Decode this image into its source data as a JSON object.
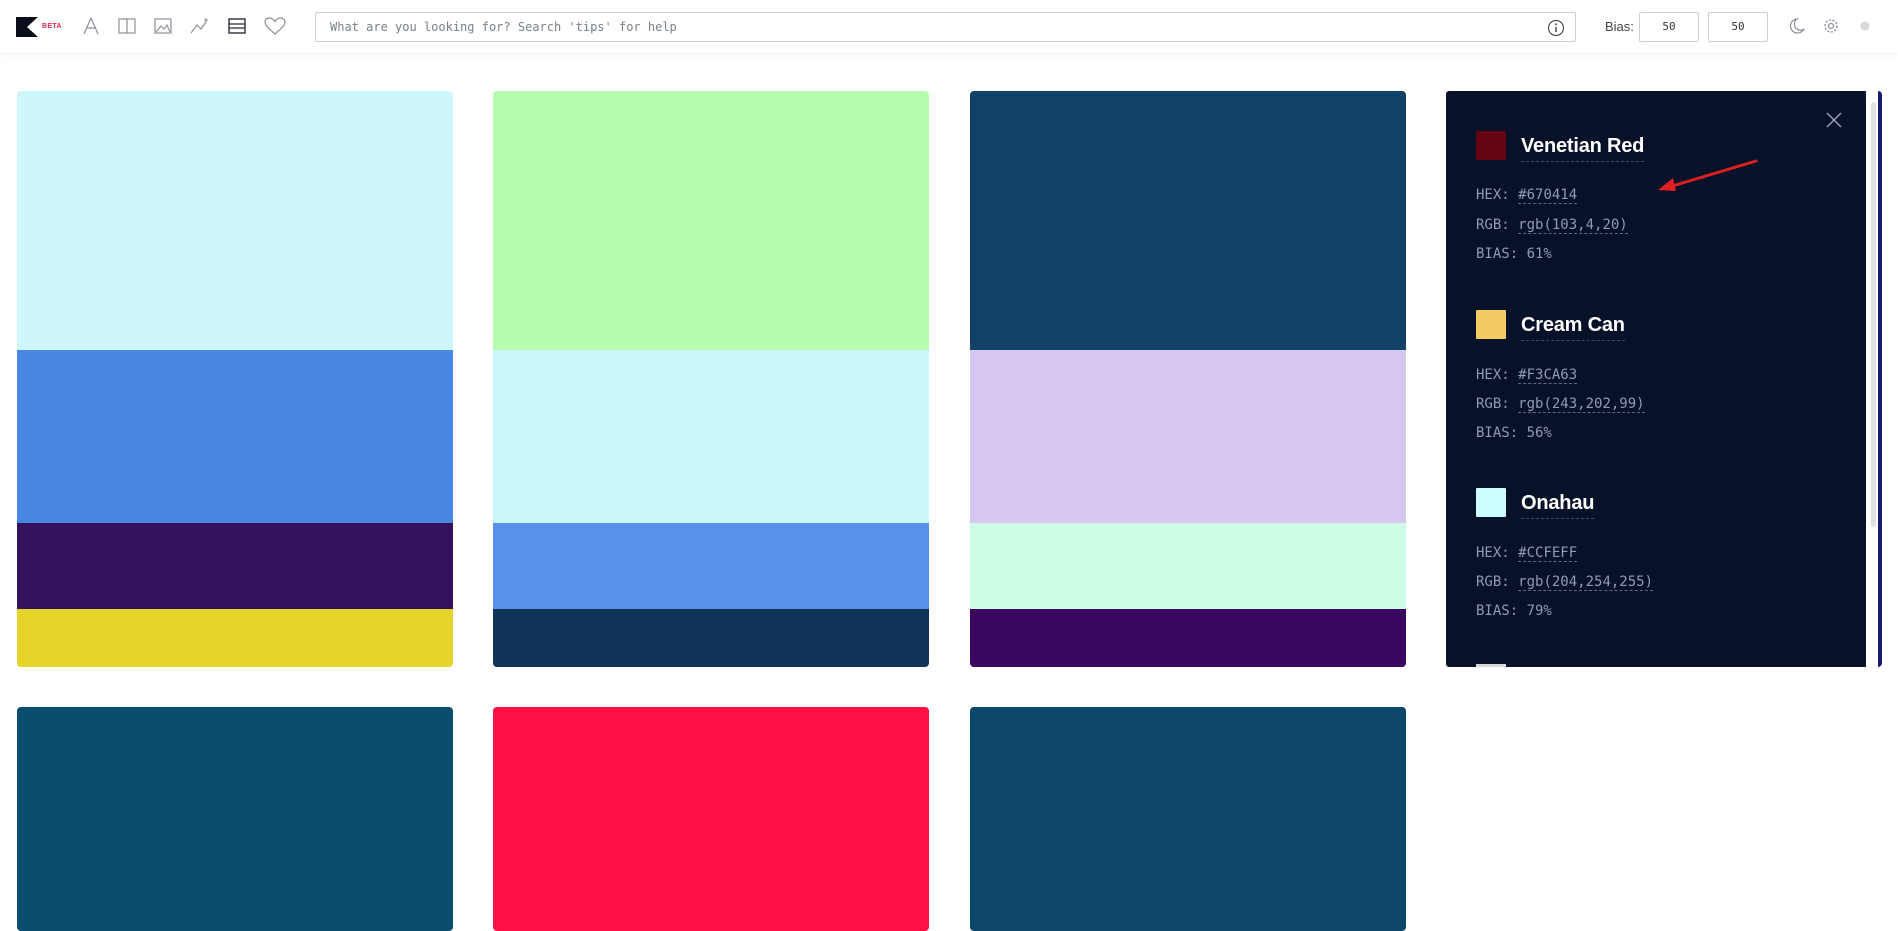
{
  "header": {
    "brand_badge": "BETA",
    "tools": [
      {
        "icon": "font-icon"
      },
      {
        "icon": "columns-icon"
      },
      {
        "icon": "image-icon"
      },
      {
        "icon": "sparkle-chart-icon"
      },
      {
        "icon": "list-icon"
      },
      {
        "icon": "heart-icon"
      }
    ],
    "search": {
      "placeholder": "What are you looking for? Search 'tips' for help",
      "value": ""
    },
    "bias": {
      "label": "Bias:",
      "value_1": "50",
      "value_2": "50"
    },
    "right_icons": [
      "moon-icon",
      "gear-icon",
      "status-dot-icon"
    ]
  },
  "palettes": [
    {
      "swatches": [
        {
          "color": "#CFF7FB",
          "weight": 45
        },
        {
          "color": "#4787E2",
          "weight": 30
        },
        {
          "color": "#34115C",
          "weight": 15
        },
        {
          "color": "#E5D52A",
          "weight": 10
        }
      ]
    },
    {
      "swatches": [
        {
          "color": "#B6FCB0",
          "weight": 45
        },
        {
          "color": "#CAF7F9",
          "weight": 30
        },
        {
          "color": "#5890EC",
          "weight": 15
        },
        {
          "color": "#123358",
          "weight": 10
        }
      ]
    },
    {
      "swatches": [
        {
          "color": "#114166",
          "weight": 45
        },
        {
          "color": "#D5C7F1",
          "weight": 30
        },
        {
          "color": "#CDFDE5",
          "weight": 15
        },
        {
          "color": "#3B0760",
          "weight": 10
        }
      ]
    },
    {
      "swatches": [
        {
          "color": "#151A79",
          "weight": 100
        }
      ]
    },
    {
      "swatches": [
        {
          "color": "#0C4C6E",
          "weight": 100
        }
      ]
    },
    {
      "swatches": [
        {
          "color": "#FF1044",
          "weight": 100
        }
      ]
    },
    {
      "swatches": [
        {
          "color": "#0D4769",
          "weight": 100
        }
      ]
    }
  ],
  "detail_panel": {
    "colors": [
      {
        "name": "Venetian Red",
        "chip": "#670414",
        "hex_label": "HEX:",
        "hex": "#670414",
        "rgb_label": "RGB:",
        "rgb": "rgb(103,4,20)",
        "bias_text": "BIAS: 61%"
      },
      {
        "name": "Cream Can",
        "chip": "#F3CA63",
        "hex_label": "HEX:",
        "hex": "#F3CA63",
        "rgb_label": "RGB:",
        "rgb": "rgb(243,202,99)",
        "bias_text": "BIAS: 56%"
      },
      {
        "name": "Onahau",
        "chip": "#CCFEFF",
        "hex_label": "HEX:",
        "hex": "#CCFEFF",
        "rgb_label": "RGB:",
        "rgb": "rgb(204,254,255)",
        "bias_text": "BIAS: 79%"
      }
    ]
  },
  "theme": {
    "panel_bg": "#071128",
    "accent_red": "#e0284a",
    "annotation_arrow": "#e02020"
  }
}
